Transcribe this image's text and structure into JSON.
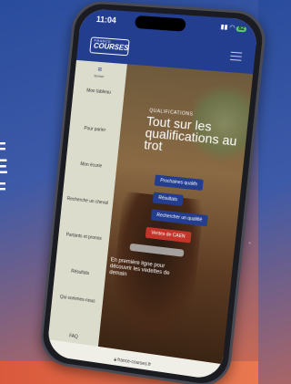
{
  "status_bar": {
    "time": "11:04",
    "battery": "82"
  },
  "header": {
    "logo_top": "FRANCE",
    "logo_main": "COURSES"
  },
  "sidebar": {
    "toggle_label": "fermer",
    "items": [
      {
        "label": "Mon tableau"
      },
      {
        "label": "Pour parier"
      },
      {
        "label": "Mon écurie"
      },
      {
        "label": "Recherche un cheval"
      },
      {
        "label": "Partants et pronos"
      },
      {
        "label": "Résultats"
      },
      {
        "label": "Qui sommes-nous"
      },
      {
        "label": "FAQ"
      }
    ]
  },
  "hero": {
    "kicker": "QUALIFICATIONS",
    "title": "Tout sur les qualifications au trot",
    "buttons": [
      {
        "label": "Prochaines qualifs",
        "color": "#233d8f"
      },
      {
        "label": "Résultats",
        "color": "#233d8f"
      },
      {
        "label": "Rechercher un qualifié",
        "color": "#233d8f"
      },
      {
        "label": "Ventes de CAEN",
        "color": "#c2352a"
      }
    ],
    "subtitle": "En première ligne pour découvrir les vedettes de demain"
  },
  "url_bar": {
    "url": "france-courses.fr"
  }
}
